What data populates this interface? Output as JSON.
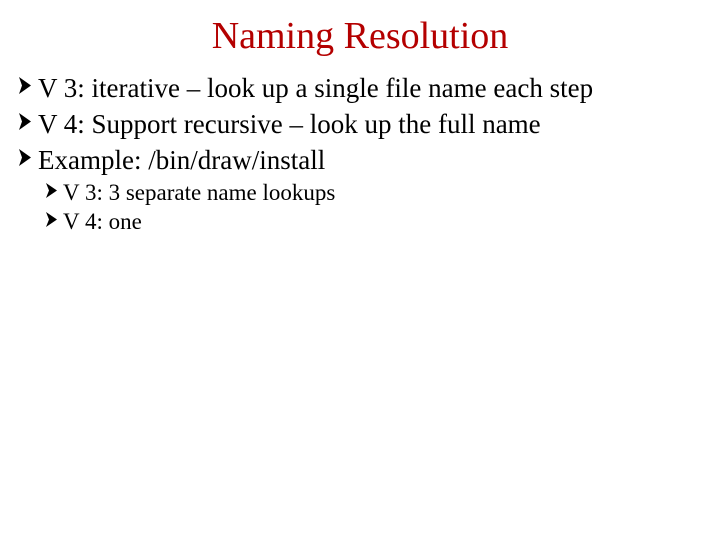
{
  "title": "Naming Resolution",
  "items": [
    "V 3: iterative – look up a single file name each step",
    "V 4: Support recursive – look up the full name",
    "Example: /bin/draw/install"
  ],
  "subitems": [
    "V 3: 3 separate name lookups",
    "V 4: one"
  ]
}
